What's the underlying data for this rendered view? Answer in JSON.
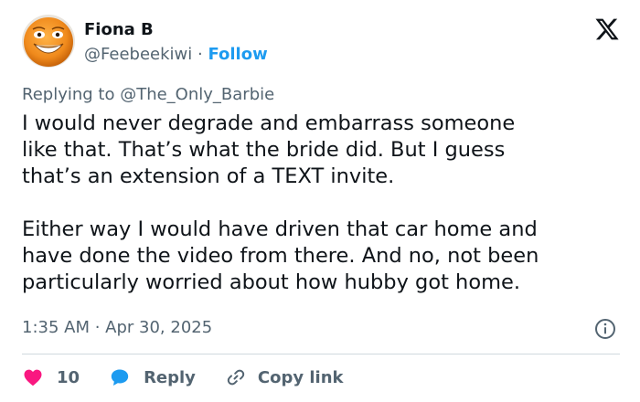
{
  "author": {
    "name": "Fiona B",
    "handle": "@Feebeekiwi",
    "separator": "·",
    "follow_label": "Follow",
    "avatar_icon": "smiling-emoji-avatar"
  },
  "logo_icon": "x-logo-icon",
  "reply_context": {
    "prefix": "Replying to ",
    "target": "@The_Only_Barbie"
  },
  "tweet": {
    "paragraph1": "I would never degrade and embarrass someone\nlike that. That’s what the bride did. But I guess\nthat’s an extension of a TEXT invite.",
    "paragraph2": "Either way I would have driven that car home and\nhave done the video from there. And no, not been\nparticularly worried about how hubby got home."
  },
  "timestamp": "1:35 AM · Apr 30, 2025",
  "actions": {
    "like_count": "10",
    "reply_label": "Reply",
    "copy_label": "Copy link"
  },
  "colors": {
    "text": "#0f1419",
    "secondary": "#536471",
    "accent": "#1d9bf0",
    "like": "#f91880",
    "divider": "#cfd9de"
  }
}
